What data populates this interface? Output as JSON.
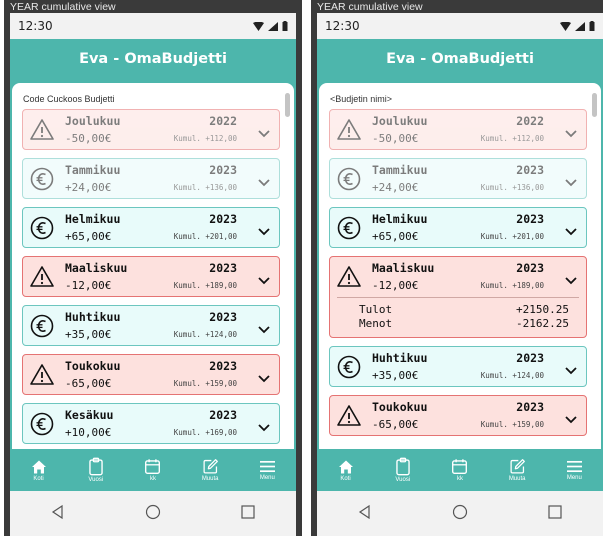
{
  "colors": {
    "accent": "#4db6ac",
    "negative_bg": "#fde1de",
    "negative_border": "#e57373",
    "positive_bg": "#e8fbfa",
    "positive_border": "#6cc6bf"
  },
  "caption": "YEAR cumulative view",
  "status_time": "12:30",
  "app_title": "Eva - OmaBudjetti",
  "left": {
    "budget_name": "Code Cuckoos Budjetti",
    "cards": [
      {
        "month": "Joulukuu",
        "year": "2022",
        "amount": "-50,00€",
        "cumul": "Kumul. +112,00",
        "kind": "neg",
        "faded": true
      },
      {
        "month": "Tammikuu",
        "year": "2023",
        "amount": "+24,00€",
        "cumul": "Kumul. +136,00",
        "kind": "pos",
        "faded": true
      },
      {
        "month": "Helmikuu",
        "year": "2023",
        "amount": "+65,00€",
        "cumul": "Kumul. +201,00",
        "kind": "pos",
        "faded": false
      },
      {
        "month": "Maaliskuu",
        "year": "2023",
        "amount": "-12,00€",
        "cumul": "Kumul. +189,00",
        "kind": "neg",
        "faded": false
      },
      {
        "month": "Huhtikuu",
        "year": "2023",
        "amount": "+35,00€",
        "cumul": "Kumul. +124,00",
        "kind": "pos",
        "faded": false
      },
      {
        "month": "Toukokuu",
        "year": "2023",
        "amount": "-65,00€",
        "cumul": "Kumul. +159,00",
        "kind": "neg",
        "faded": false
      },
      {
        "month": "Kesäkuu",
        "year": "2023",
        "amount": "+10,00€",
        "cumul": "Kumul. +169,00",
        "kind": "pos",
        "faded": false
      }
    ]
  },
  "right": {
    "budget_name": "<Budjetin nimi>",
    "cards": [
      {
        "month": "Joulukuu",
        "year": "2022",
        "amount": "-50,00€",
        "cumul": "Kumul. +112,00",
        "kind": "neg",
        "faded": true
      },
      {
        "month": "Tammikuu",
        "year": "2023",
        "amount": "+24,00€",
        "cumul": "Kumul. +136,00",
        "kind": "pos",
        "faded": true
      },
      {
        "month": "Helmikuu",
        "year": "2023",
        "amount": "+65,00€",
        "cumul": "Kumul. +201,00",
        "kind": "pos",
        "faded": false
      },
      {
        "month": "Maaliskuu",
        "year": "2023",
        "amount": "-12,00€",
        "cumul": "Kumul. +189,00",
        "kind": "neg",
        "faded": false,
        "details": [
          {
            "label": "Tulot",
            "value": "+2150.25"
          },
          {
            "label": "Menot",
            "value": "-2162.25"
          }
        ]
      },
      {
        "month": "Huhtikuu",
        "year": "2023",
        "amount": "+35,00€",
        "cumul": "Kumul. +124,00",
        "kind": "pos",
        "faded": false
      },
      {
        "month": "Toukokuu",
        "year": "2023",
        "amount": "-65,00€",
        "cumul": "Kumul. +159,00",
        "kind": "neg",
        "faded": false
      }
    ]
  },
  "nav": [
    {
      "label": "Koti",
      "icon": "home-icon"
    },
    {
      "label": "Vuosi",
      "icon": "clipboard-icon"
    },
    {
      "label": "kk",
      "icon": "calendar-icon"
    },
    {
      "label": "Muuta",
      "icon": "edit-icon"
    },
    {
      "label": "Menu",
      "icon": "menu-icon"
    }
  ],
  "system_nav": [
    "back-icon",
    "home-circle-icon",
    "recents-icon"
  ]
}
